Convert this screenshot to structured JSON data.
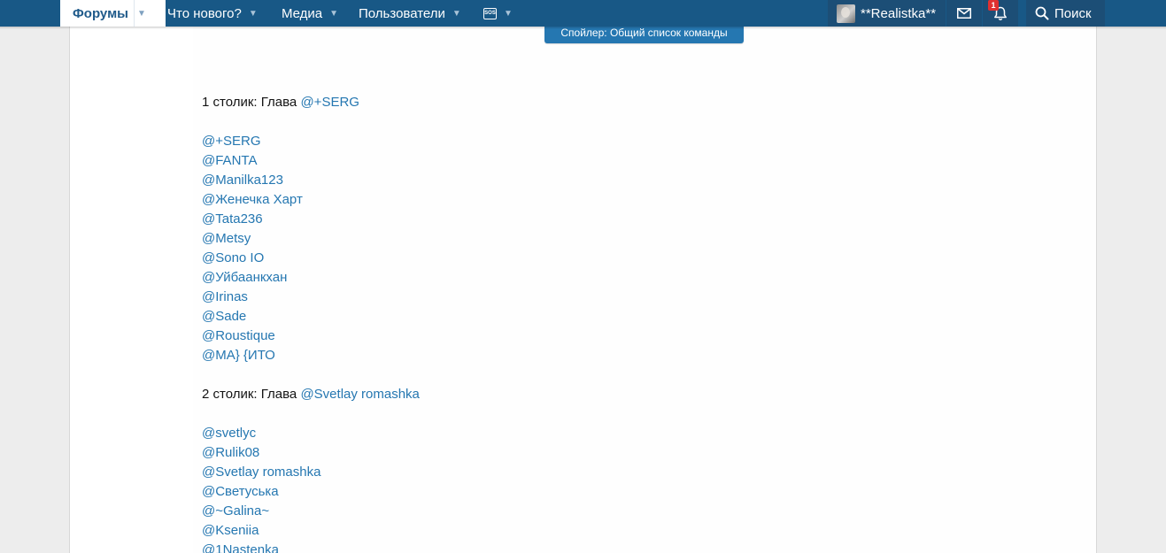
{
  "nav": {
    "forums": "Форумы",
    "whats_new": "Что нового?",
    "media": "Медиа",
    "users": "Пользователи",
    "sos_icon": "sos-icon",
    "sos_label": "SOS",
    "username": "**Realistka**",
    "alerts_count": "1",
    "search": "Поиск"
  },
  "spoiler": {
    "label": "Спойлер: Общий список команды"
  },
  "tables": [
    {
      "heading": "1 столик: Глава ",
      "leader": "@+SERG",
      "members": [
        "@+SERG",
        "@FANTA",
        "@Manilka123",
        "@Женечка Харт",
        "@Tata236",
        "@Metsy",
        "@Sono IO",
        "@Уйбаанкхан",
        "@Irinas",
        "@Sade",
        "@Roustique",
        "@МА} {ИТО"
      ]
    },
    {
      "heading": "2 столик: Глава ",
      "leader": "@Svetlay romashka",
      "members": [
        "@svetlyc",
        "@Rulik08",
        "@Svetlay romashka",
        "@Светуська",
        "@~Galina~",
        "@Kseniia",
        "@1Nastenka"
      ]
    }
  ],
  "colors": {
    "nav_bg": "#185886",
    "link": "#2577b1",
    "badge": "#e03030"
  }
}
